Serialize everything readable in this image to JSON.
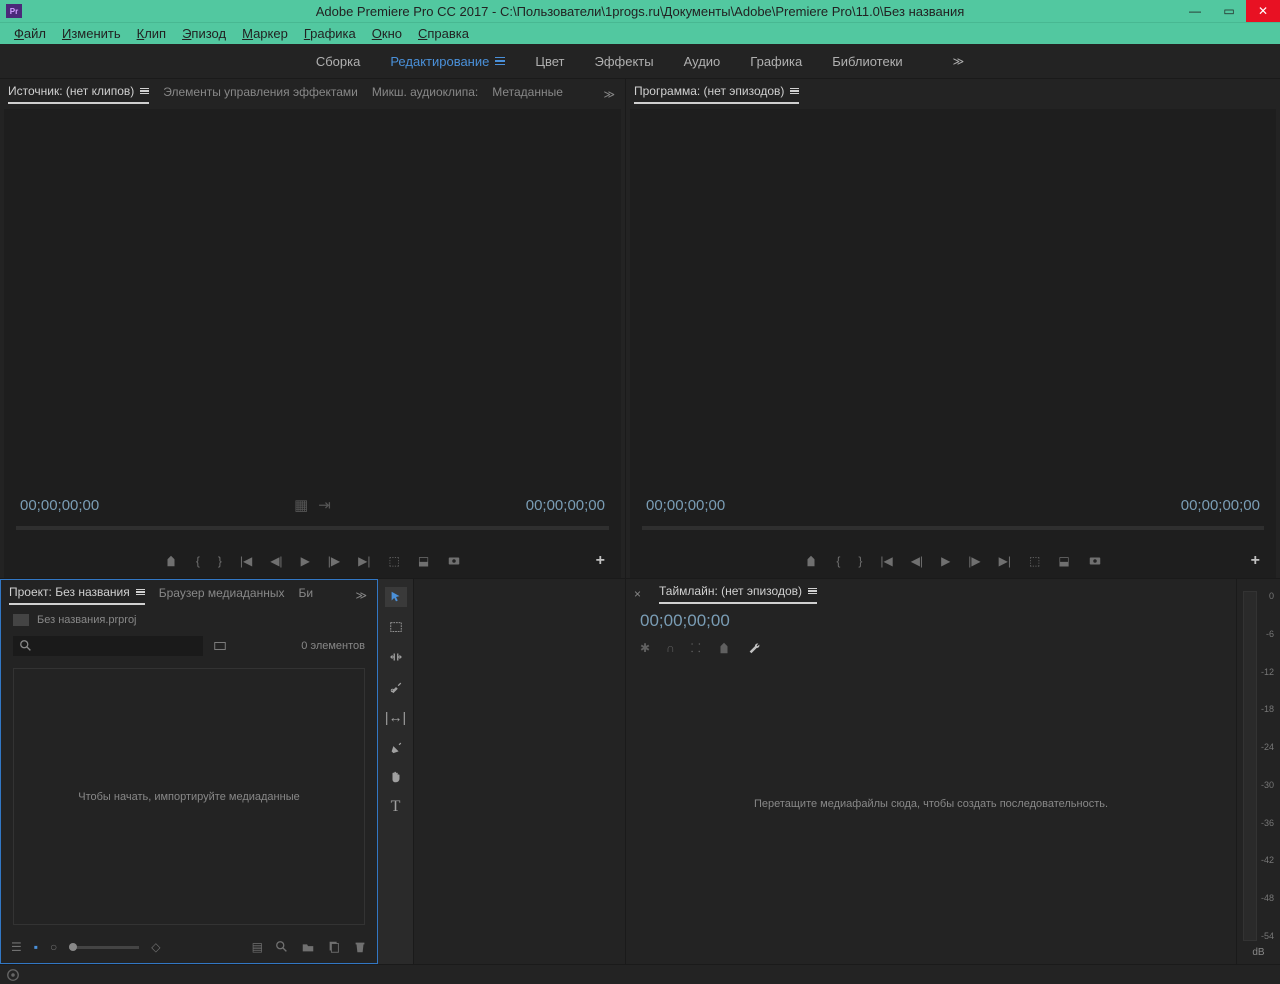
{
  "titlebar": {
    "app_abbrev": "Pr",
    "title": "Adobe Premiere Pro CC 2017 - C:\\Пользователи\\1progs.ru\\Документы\\Adobe\\Premiere Pro\\11.0\\Без названия"
  },
  "menu": {
    "file": "Файл",
    "edit": "Изменить",
    "clip": "Клип",
    "sequence": "Эпизод",
    "marker": "Маркер",
    "graphics": "Графика",
    "window": "Окно",
    "help": "Справка"
  },
  "workspaces": {
    "assembly": "Сборка",
    "editing": "Редактирование",
    "color": "Цвет",
    "effects": "Эффекты",
    "audio": "Аудио",
    "graphics": "Графика",
    "libraries": "Библиотеки"
  },
  "source_panel": {
    "tab_source": "Источник: (нет клипов)",
    "tab_effects": "Элементы управления эффектами",
    "tab_mixer": "Микш. аудиоклипа:",
    "tab_metadata": "Метаданные",
    "tc_left": "00;00;00;00",
    "tc_right": "00;00;00;00"
  },
  "program_panel": {
    "tab_program": "Программа: (нет эпизодов)",
    "tc_left": "00;00;00;00",
    "tc_right": "00;00;00;00"
  },
  "project_panel": {
    "tab_project": "Проект: Без названия",
    "tab_media": "Браузер медиаданных",
    "tab_more": "Би",
    "filename": "Без названия.prproj",
    "search_placeholder": "",
    "item_count": "0 элементов",
    "drop_hint": "Чтобы начать, импортируйте медиаданные"
  },
  "timeline_panel": {
    "tab_timeline": "Таймлайн: (нет эпизодов)",
    "tc": "00;00;00;00",
    "drop_hint": "Перетащите медиафайлы сюда, чтобы создать последовательность."
  },
  "audio_meter": {
    "ticks": [
      "0",
      "-6",
      "-12",
      "-18",
      "-24",
      "-30",
      "-36",
      "-42",
      "-48",
      "-54"
    ],
    "label": "dB"
  }
}
